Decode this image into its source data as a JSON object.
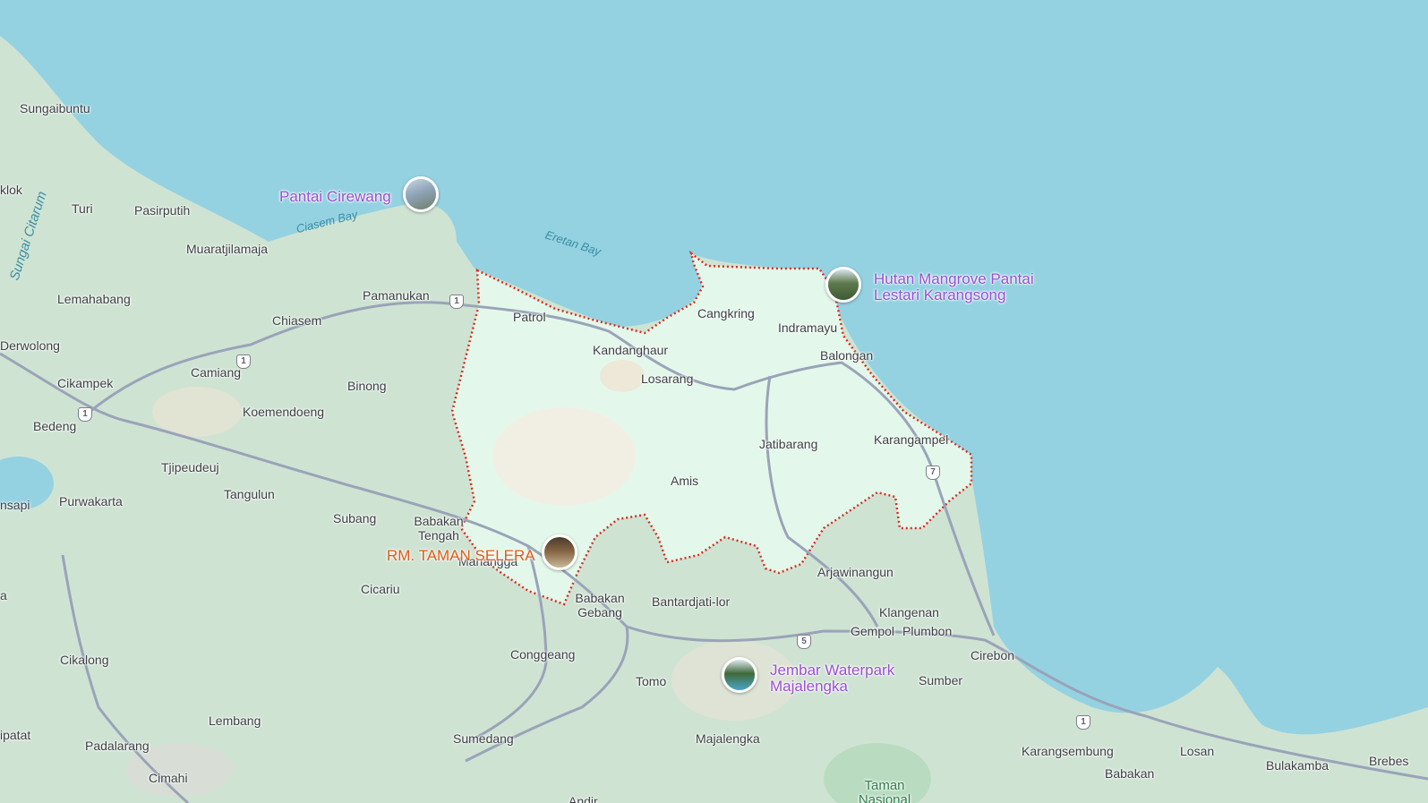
{
  "colors": {
    "sea": "#94d2e2",
    "land": "#cfe3d3",
    "highlight": "#e3f8ea",
    "boundary": "#d93025",
    "road": "#9aa3b8",
    "poi": "#9a4fd0",
    "restaurant": "#e05a12"
  },
  "water_labels": {
    "ciasem": "Ciasem Bay",
    "eretan": "Eretan Bay",
    "citarum": "Sungai Citarum"
  },
  "places": {
    "sungaibuntu": "Sungaibuntu",
    "klok": "klok",
    "turi": "Turi",
    "pasirputih": "Pasirputih",
    "muaratjilamaja": "Muaratjilamaja",
    "lemahabang": "Lemahabang",
    "pamanukan": "Pamanukan",
    "chiasem": "Chiasem",
    "patrol": "Patrol",
    "cangkring": "Cangkring",
    "indramayu": "Indramayu",
    "kandanghaur": "Kandanghaur",
    "balongan": "Balongan",
    "derwolong": "Derwolong",
    "camiang": "Camiang",
    "cikampek": "Cikampek",
    "binong": "Binong",
    "losarang": "Losarang",
    "koemendoeng": "Koemendoeng",
    "bedeng": "Bedeng",
    "jatibarang": "Jatibarang",
    "karangampel": "Karangampel",
    "tjipeudeuj": "Tjipeudeuj",
    "amis": "Amis",
    "tangulun": "Tangulun",
    "purwakarta": "Purwakarta",
    "nsapi": "nsapi",
    "subang": "Subang",
    "babakan_tengah": "Babakan Tengah",
    "manangga": "Manangga",
    "arjawinangun": "Arjawinangun",
    "cicariu": "Cicariu",
    "a": "a",
    "babakan_gebang": "Babakan Gebang",
    "bantardjati": "Bantardjati-lor",
    "klangenan": "Klangenan",
    "gempol": "Gempol",
    "plumbon": "Plumbon",
    "cikalong": "Cikalong",
    "conggeang": "Conggeang",
    "cirebon": "Cirebon",
    "tomo": "Tomo",
    "sumber": "Sumber",
    "lembang": "Lembang",
    "ipatat": "ipatat",
    "padalarang": "Padalarang",
    "sumedang": "Sumedang",
    "majalengka": "Majalengka",
    "karangsembung": "Karangsembung",
    "losan": "Losan",
    "bulakamba": "Bulakamba",
    "brebes": "Brebes",
    "babakan": "Babakan",
    "cimahi": "Cimahi",
    "taman_nasional": "Taman Nasional",
    "andir": "Andir"
  },
  "road_shields": {
    "r1": "1",
    "r5": "5",
    "r7": "7"
  },
  "pois": {
    "pantai_cirewang": "Pantai Cirewang",
    "hutan_mangrove": "Hutan Mangrove Pantai Lestari Karangsong",
    "taman_selera": "RM. TAMAN SELERA",
    "jembar": "Jembar Waterpark Majalengka"
  }
}
